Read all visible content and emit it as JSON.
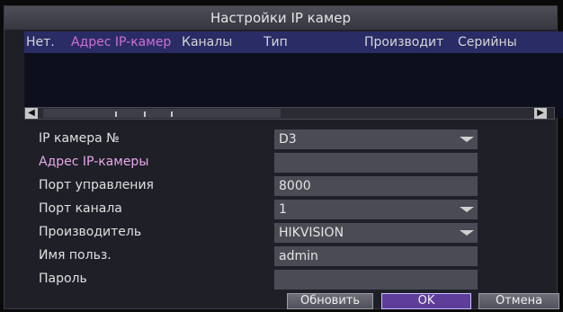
{
  "dialog": {
    "title": "Настройки IP камер"
  },
  "table": {
    "columns": [
      {
        "label": "Нет."
      },
      {
        "label": "Адрес IP-камер"
      },
      {
        "label": "Каналы"
      },
      {
        "label": "Тип"
      },
      {
        "label": "Производит"
      },
      {
        "label": "Серийны"
      }
    ],
    "rows": []
  },
  "form": {
    "camera_no": {
      "label": "IP камера №",
      "value": "D3"
    },
    "ip_address": {
      "label": "Адрес IP-камеры",
      "value": ""
    },
    "control_port": {
      "label": "Порт управления",
      "value": "8000"
    },
    "channel_port": {
      "label": "Порт канала",
      "value": "1"
    },
    "manufacturer": {
      "label": "Производитель",
      "value": "HIKVISION"
    },
    "username": {
      "label": "Имя польз.",
      "value": "admin"
    },
    "password": {
      "label": "Пароль",
      "value": ""
    }
  },
  "buttons": {
    "refresh": "Обновить",
    "ok": "OK",
    "cancel": "Отмена"
  },
  "colors": {
    "header_bg": "#2a2c66",
    "field_bg": "#4a4b55",
    "title_bg": "#45464f",
    "selected_button": "#5f3d9a"
  }
}
